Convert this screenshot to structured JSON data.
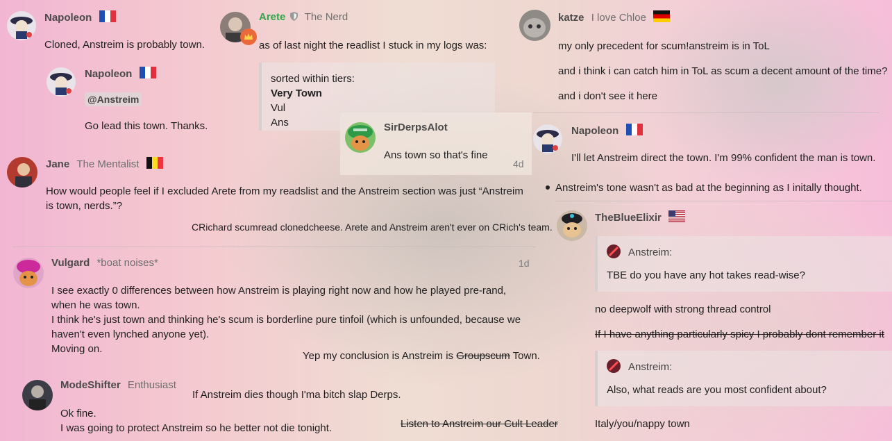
{
  "posts": {
    "napoleon_top": {
      "name": "Napoleon",
      "text": "Cloned, Anstreim is probably town."
    },
    "napoleon_nested": {
      "name": "Napoleon",
      "mention": "@Anstreim",
      "text": "Go lead this town. Thanks."
    },
    "arete": {
      "name": "Arete",
      "title": "The Nerd",
      "intro": "as of last night the readlist I stuck in my logs was:",
      "quote_lines": [
        "sorted within tiers:",
        "Very Town",
        "Vul",
        "Ans"
      ]
    },
    "sirderps": {
      "name": "SirDerpsAlot",
      "text": "Ans town so that's fine",
      "date": "4d"
    },
    "katze": {
      "name": "katze",
      "title": "I love Chloe",
      "lines": [
        "my only precedent for scum!anstreim is in ToL",
        "and i think i can catch him in ToL as scum a decent amount of the time?",
        "and i don't see it here"
      ]
    },
    "napoleon_right": {
      "name": "Napoleon",
      "text": "I'll let Anstreim direct the town. I'm 99% confident the man is town.",
      "bullet": "Anstreim's tone wasn't as bad at the beginning as I initally thought."
    },
    "jane": {
      "name": "Jane",
      "title": "The Mentalist",
      "text": "How would people feel if I excluded Arete from my readslist and the Anstreim section was just “Anstreim is town, nerds.”?",
      "footnote": "CRichard scumread clonedcheese. Arete and Anstreim aren't ever on CRich's team."
    },
    "vulgard": {
      "name": "Vulgard",
      "title": "*boat noises*",
      "date": "1d",
      "lines": [
        "I see exactly 0 differences between how Anstreim is playing right now and how he played pre-rand,",
        "when he was town.",
        "I think he's just town and thinking he's scum is borderline pure tinfoil (which is unfounded, because we",
        "haven't even lynched anyone yet).",
        "Moving on."
      ],
      "conclusion_pre": "Yep my conclusion is Anstreim is ",
      "conclusion_strike": "Groupscum",
      "conclusion_post": " Town."
    },
    "modeshifter": {
      "name": "ModeShifter",
      "title": "Enthusiast",
      "aside": "If Anstreim dies though I'ma bitch slap Derps.",
      "lines": [
        "Ok fine.",
        "I was going to protect Anstreim so he better not die tonight."
      ],
      "strike": "Listen to Anstreim our Cult Leader"
    },
    "blueelixir": {
      "name": "TheBlueElixir",
      "quote1_author": "Anstreim:",
      "quote1_text": "TBE do you have any hot takes read-wise?",
      "reply1": "no deepwolf with strong thread control",
      "strike": "If I have anything particularly spicy I probably dont remember it",
      "quote2_author": "Anstreim:",
      "quote2_text": "Also, what reads are you most confident about?",
      "reply2": "Italy/you/nappy town"
    }
  },
  "colors": {
    "username": "#4a4a4a",
    "staff_green": "#2fa84b",
    "moderator_badge": "#e9693a"
  }
}
